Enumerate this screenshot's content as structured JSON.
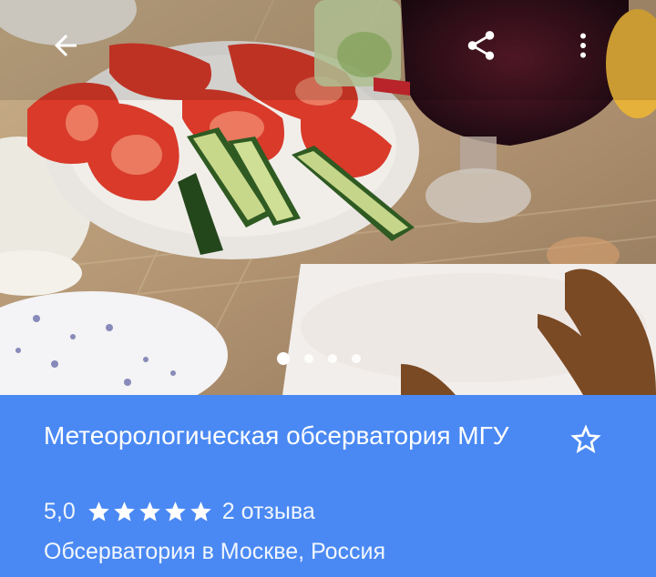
{
  "toolbar": {
    "back_icon": "arrow-back-icon",
    "share_icon": "share-icon",
    "more_icon": "more-vert-icon"
  },
  "gallery": {
    "photo_count": 4,
    "active_index": 0
  },
  "place": {
    "title": "Метеорологическая обсерватория МГУ",
    "rating": "5,0",
    "stars": 5,
    "reviews": "2 отзыва",
    "category": "Обсерватория в Москве, Россия",
    "save_icon": "star-outline-icon"
  },
  "colors": {
    "panel_bg": "#4a89f3",
    "text": "#ffffff"
  }
}
